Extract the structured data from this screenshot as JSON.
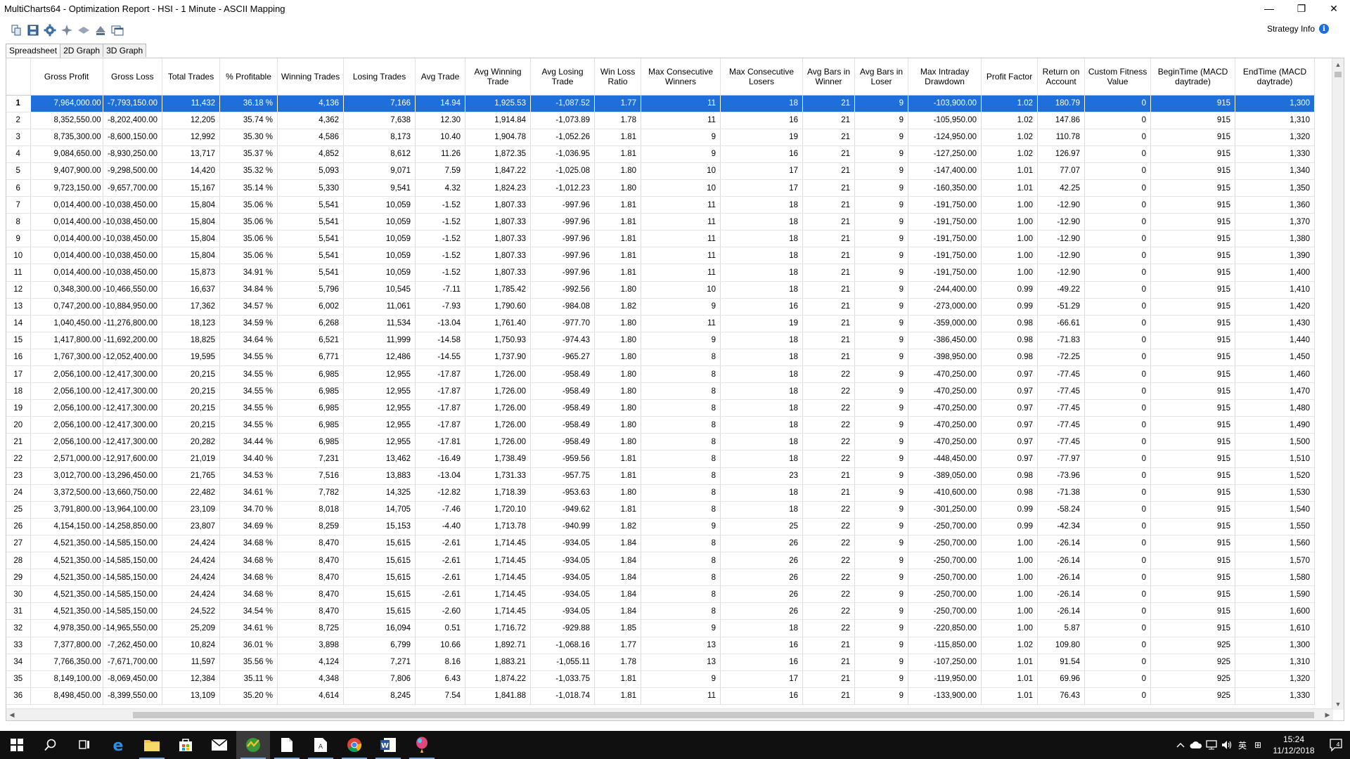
{
  "window": {
    "title": "MultiCharts64 - Optimization Report - HSI - 1 Minute - ASCII Mapping",
    "minimize": "—",
    "restore": "❐",
    "close": "✕"
  },
  "toolbar": {
    "icons": [
      "copy-icon",
      "save-icon",
      "settings-gear-icon",
      "optimize-icon",
      "hide-icon",
      "filter-icon",
      "window-icon"
    ],
    "strategy_info_label": "Strategy Info",
    "info_glyph": "i"
  },
  "tabs": [
    {
      "label": "Spreadsheet",
      "active": true
    },
    {
      "label": "2D Graph",
      "active": false
    },
    {
      "label": "3D Graph",
      "active": false
    }
  ],
  "grid": {
    "selected_row": 1,
    "columns": [
      {
        "key": "gp",
        "label": "Gross Profit"
      },
      {
        "key": "gl",
        "label": "Gross Loss"
      },
      {
        "key": "tt",
        "label": "Total Trades"
      },
      {
        "key": "pp",
        "label": "% Profitable"
      },
      {
        "key": "wt",
        "label": "Winning Trades"
      },
      {
        "key": "lt",
        "label": "Losing Trades"
      },
      {
        "key": "at",
        "label": "Avg Trade"
      },
      {
        "key": "awt",
        "label": "Avg Winning Trade"
      },
      {
        "key": "alt",
        "label": "Avg Losing Trade"
      },
      {
        "key": "wlr",
        "label": "Win Loss Ratio"
      },
      {
        "key": "mcw",
        "label": "Max Consecutive Winners"
      },
      {
        "key": "mcl",
        "label": "Max Consecutive Losers"
      },
      {
        "key": "abw",
        "label": "Avg Bars in Winner"
      },
      {
        "key": "abl",
        "label": "Avg Bars in Loser"
      },
      {
        "key": "mid",
        "label": "Max Intraday Drawdown"
      },
      {
        "key": "pf",
        "label": "Profit Factor"
      },
      {
        "key": "roa",
        "label": "Return on Account"
      },
      {
        "key": "cfv",
        "label": "Custom Fitness Value"
      },
      {
        "key": "bt",
        "label": "BeginTime (MACD daytrade)"
      },
      {
        "key": "et",
        "label": "EndTime (MACD daytrade)"
      }
    ],
    "rows": [
      [
        "1",
        "7,964,000.00",
        "-7,793,150.00",
        "11,432",
        "36.18 %",
        "4,136",
        "7,166",
        "14.94",
        "1,925.53",
        "-1,087.52",
        "1.77",
        "11",
        "18",
        "21",
        "9",
        "-103,900.00",
        "1.02",
        "180.79",
        "0",
        "915",
        "1,300"
      ],
      [
        "2",
        "8,352,550.00",
        "-8,202,400.00",
        "12,205",
        "35.74 %",
        "4,362",
        "7,638",
        "12.30",
        "1,914.84",
        "-1,073.89",
        "1.78",
        "11",
        "16",
        "21",
        "9",
        "-105,950.00",
        "1.02",
        "147.86",
        "0",
        "915",
        "1,310"
      ],
      [
        "3",
        "8,735,300.00",
        "-8,600,150.00",
        "12,992",
        "35.30 %",
        "4,586",
        "8,173",
        "10.40",
        "1,904.78",
        "-1,052.26",
        "1.81",
        "9",
        "19",
        "21",
        "9",
        "-124,950.00",
        "1.02",
        "110.78",
        "0",
        "915",
        "1,320"
      ],
      [
        "4",
        "9,084,650.00",
        "-8,930,250.00",
        "13,717",
        "35.37 %",
        "4,852",
        "8,612",
        "11.26",
        "1,872.35",
        "-1,036.95",
        "1.81",
        "9",
        "16",
        "21",
        "9",
        "-127,250.00",
        "1.02",
        "126.97",
        "0",
        "915",
        "1,330"
      ],
      [
        "5",
        "9,407,900.00",
        "-9,298,500.00",
        "14,420",
        "35.32 %",
        "5,093",
        "9,071",
        "7.59",
        "1,847.22",
        "-1,025.08",
        "1.80",
        "10",
        "17",
        "21",
        "9",
        "-147,400.00",
        "1.01",
        "77.07",
        "0",
        "915",
        "1,340"
      ],
      [
        "6",
        "9,723,150.00",
        "-9,657,700.00",
        "15,167",
        "35.14 %",
        "5,330",
        "9,541",
        "4.32",
        "1,824.23",
        "-1,012.23",
        "1.80",
        "10",
        "17",
        "21",
        "9",
        "-160,350.00",
        "1.01",
        "42.25",
        "0",
        "915",
        "1,350"
      ],
      [
        "7",
        "0,014,400.00",
        "-10,038,450.00",
        "15,804",
        "35.06 %",
        "5,541",
        "10,059",
        "-1.52",
        "1,807.33",
        "-997.96",
        "1.81",
        "11",
        "18",
        "21",
        "9",
        "-191,750.00",
        "1.00",
        "-12.90",
        "0",
        "915",
        "1,360"
      ],
      [
        "8",
        "0,014,400.00",
        "-10,038,450.00",
        "15,804",
        "35.06 %",
        "5,541",
        "10,059",
        "-1.52",
        "1,807.33",
        "-997.96",
        "1.81",
        "11",
        "18",
        "21",
        "9",
        "-191,750.00",
        "1.00",
        "-12.90",
        "0",
        "915",
        "1,370"
      ],
      [
        "9",
        "0,014,400.00",
        "-10,038,450.00",
        "15,804",
        "35.06 %",
        "5,541",
        "10,059",
        "-1.52",
        "1,807.33",
        "-997.96",
        "1.81",
        "11",
        "18",
        "21",
        "9",
        "-191,750.00",
        "1.00",
        "-12.90",
        "0",
        "915",
        "1,380"
      ],
      [
        "10",
        "0,014,400.00",
        "-10,038,450.00",
        "15,804",
        "35.06 %",
        "5,541",
        "10,059",
        "-1.52",
        "1,807.33",
        "-997.96",
        "1.81",
        "11",
        "18",
        "21",
        "9",
        "-191,750.00",
        "1.00",
        "-12.90",
        "0",
        "915",
        "1,390"
      ],
      [
        "11",
        "0,014,400.00",
        "-10,038,450.00",
        "15,873",
        "34.91 %",
        "5,541",
        "10,059",
        "-1.52",
        "1,807.33",
        "-997.96",
        "1.81",
        "11",
        "18",
        "21",
        "9",
        "-191,750.00",
        "1.00",
        "-12.90",
        "0",
        "915",
        "1,400"
      ],
      [
        "12",
        "0,348,300.00",
        "-10,466,550.00",
        "16,637",
        "34.84 %",
        "5,796",
        "10,545",
        "-7.11",
        "1,785.42",
        "-992.56",
        "1.80",
        "10",
        "18",
        "21",
        "9",
        "-244,400.00",
        "0.99",
        "-49.22",
        "0",
        "915",
        "1,410"
      ],
      [
        "13",
        "0,747,200.00",
        "-10,884,950.00",
        "17,362",
        "34.57 %",
        "6,002",
        "11,061",
        "-7.93",
        "1,790.60",
        "-984.08",
        "1.82",
        "9",
        "16",
        "21",
        "9",
        "-273,000.00",
        "0.99",
        "-51.29",
        "0",
        "915",
        "1,420"
      ],
      [
        "14",
        "1,040,450.00",
        "-11,276,800.00",
        "18,123",
        "34.59 %",
        "6,268",
        "11,534",
        "-13.04",
        "1,761.40",
        "-977.70",
        "1.80",
        "11",
        "19",
        "21",
        "9",
        "-359,000.00",
        "0.98",
        "-66.61",
        "0",
        "915",
        "1,430"
      ],
      [
        "15",
        "1,417,800.00",
        "-11,692,200.00",
        "18,825",
        "34.64 %",
        "6,521",
        "11,999",
        "-14.58",
        "1,750.93",
        "-974.43",
        "1.80",
        "9",
        "18",
        "21",
        "9",
        "-386,450.00",
        "0.98",
        "-71.83",
        "0",
        "915",
        "1,440"
      ],
      [
        "16",
        "1,767,300.00",
        "-12,052,400.00",
        "19,595",
        "34.55 %",
        "6,771",
        "12,486",
        "-14.55",
        "1,737.90",
        "-965.27",
        "1.80",
        "8",
        "18",
        "21",
        "9",
        "-398,950.00",
        "0.98",
        "-72.25",
        "0",
        "915",
        "1,450"
      ],
      [
        "17",
        "2,056,100.00",
        "-12,417,300.00",
        "20,215",
        "34.55 %",
        "6,985",
        "12,955",
        "-17.87",
        "1,726.00",
        "-958.49",
        "1.80",
        "8",
        "18",
        "22",
        "9",
        "-470,250.00",
        "0.97",
        "-77.45",
        "0",
        "915",
        "1,460"
      ],
      [
        "18",
        "2,056,100.00",
        "-12,417,300.00",
        "20,215",
        "34.55 %",
        "6,985",
        "12,955",
        "-17.87",
        "1,726.00",
        "-958.49",
        "1.80",
        "8",
        "18",
        "22",
        "9",
        "-470,250.00",
        "0.97",
        "-77.45",
        "0",
        "915",
        "1,470"
      ],
      [
        "19",
        "2,056,100.00",
        "-12,417,300.00",
        "20,215",
        "34.55 %",
        "6,985",
        "12,955",
        "-17.87",
        "1,726.00",
        "-958.49",
        "1.80",
        "8",
        "18",
        "22",
        "9",
        "-470,250.00",
        "0.97",
        "-77.45",
        "0",
        "915",
        "1,480"
      ],
      [
        "20",
        "2,056,100.00",
        "-12,417,300.00",
        "20,215",
        "34.55 %",
        "6,985",
        "12,955",
        "-17.87",
        "1,726.00",
        "-958.49",
        "1.80",
        "8",
        "18",
        "22",
        "9",
        "-470,250.00",
        "0.97",
        "-77.45",
        "0",
        "915",
        "1,490"
      ],
      [
        "21",
        "2,056,100.00",
        "-12,417,300.00",
        "20,282",
        "34.44 %",
        "6,985",
        "12,955",
        "-17.81",
        "1,726.00",
        "-958.49",
        "1.80",
        "8",
        "18",
        "22",
        "9",
        "-470,250.00",
        "0.97",
        "-77.45",
        "0",
        "915",
        "1,500"
      ],
      [
        "22",
        "2,571,000.00",
        "-12,917,600.00",
        "21,019",
        "34.40 %",
        "7,231",
        "13,462",
        "-16.49",
        "1,738.49",
        "-959.56",
        "1.81",
        "8",
        "18",
        "22",
        "9",
        "-448,450.00",
        "0.97",
        "-77.97",
        "0",
        "915",
        "1,510"
      ],
      [
        "23",
        "3,012,700.00",
        "-13,296,450.00",
        "21,765",
        "34.53 %",
        "7,516",
        "13,883",
        "-13.04",
        "1,731.33",
        "-957.75",
        "1.81",
        "8",
        "23",
        "21",
        "9",
        "-389,050.00",
        "0.98",
        "-73.96",
        "0",
        "915",
        "1,520"
      ],
      [
        "24",
        "3,372,500.00",
        "-13,660,750.00",
        "22,482",
        "34.61 %",
        "7,782",
        "14,325",
        "-12.82",
        "1,718.39",
        "-953.63",
        "1.80",
        "8",
        "18",
        "21",
        "9",
        "-410,600.00",
        "0.98",
        "-71.38",
        "0",
        "915",
        "1,530"
      ],
      [
        "25",
        "3,791,800.00",
        "-13,964,100.00",
        "23,109",
        "34.70 %",
        "8,018",
        "14,705",
        "-7.46",
        "1,720.10",
        "-949.62",
        "1.81",
        "8",
        "18",
        "22",
        "9",
        "-301,250.00",
        "0.99",
        "-58.24",
        "0",
        "915",
        "1,540"
      ],
      [
        "26",
        "4,154,150.00",
        "-14,258,850.00",
        "23,807",
        "34.69 %",
        "8,259",
        "15,153",
        "-4.40",
        "1,713.78",
        "-940.99",
        "1.82",
        "9",
        "25",
        "22",
        "9",
        "-250,700.00",
        "0.99",
        "-42.34",
        "0",
        "915",
        "1,550"
      ],
      [
        "27",
        "4,521,350.00",
        "-14,585,150.00",
        "24,424",
        "34.68 %",
        "8,470",
        "15,615",
        "-2.61",
        "1,714.45",
        "-934.05",
        "1.84",
        "8",
        "26",
        "22",
        "9",
        "-250,700.00",
        "1.00",
        "-26.14",
        "0",
        "915",
        "1,560"
      ],
      [
        "28",
        "4,521,350.00",
        "-14,585,150.00",
        "24,424",
        "34.68 %",
        "8,470",
        "15,615",
        "-2.61",
        "1,714.45",
        "-934.05",
        "1.84",
        "8",
        "26",
        "22",
        "9",
        "-250,700.00",
        "1.00",
        "-26.14",
        "0",
        "915",
        "1,570"
      ],
      [
        "29",
        "4,521,350.00",
        "-14,585,150.00",
        "24,424",
        "34.68 %",
        "8,470",
        "15,615",
        "-2.61",
        "1,714.45",
        "-934.05",
        "1.84",
        "8",
        "26",
        "22",
        "9",
        "-250,700.00",
        "1.00",
        "-26.14",
        "0",
        "915",
        "1,580"
      ],
      [
        "30",
        "4,521,350.00",
        "-14,585,150.00",
        "24,424",
        "34.68 %",
        "8,470",
        "15,615",
        "-2.61",
        "1,714.45",
        "-934.05",
        "1.84",
        "8",
        "26",
        "22",
        "9",
        "-250,700.00",
        "1.00",
        "-26.14",
        "0",
        "915",
        "1,590"
      ],
      [
        "31",
        "4,521,350.00",
        "-14,585,150.00",
        "24,522",
        "34.54 %",
        "8,470",
        "15,615",
        "-2.60",
        "1,714.45",
        "-934.05",
        "1.84",
        "8",
        "26",
        "22",
        "9",
        "-250,700.00",
        "1.00",
        "-26.14",
        "0",
        "915",
        "1,600"
      ],
      [
        "32",
        "4,978,350.00",
        "-14,965,550.00",
        "25,209",
        "34.61 %",
        "8,725",
        "16,094",
        "0.51",
        "1,716.72",
        "-929.88",
        "1.85",
        "9",
        "18",
        "22",
        "9",
        "-220,850.00",
        "1.00",
        "5.87",
        "0",
        "915",
        "1,610"
      ],
      [
        "33",
        "7,377,800.00",
        "-7,262,450.00",
        "10,824",
        "36.01 %",
        "3,898",
        "6,799",
        "10.66",
        "1,892.71",
        "-1,068.16",
        "1.77",
        "13",
        "16",
        "21",
        "9",
        "-115,850.00",
        "1.02",
        "109.80",
        "0",
        "925",
        "1,300"
      ],
      [
        "34",
        "7,766,350.00",
        "-7,671,700.00",
        "11,597",
        "35.56 %",
        "4,124",
        "7,271",
        "8.16",
        "1,883.21",
        "-1,055.11",
        "1.78",
        "13",
        "16",
        "21",
        "9",
        "-107,250.00",
        "1.01",
        "91.54",
        "0",
        "925",
        "1,310"
      ],
      [
        "35",
        "8,149,100.00",
        "-8,069,450.00",
        "12,384",
        "35.11 %",
        "4,348",
        "7,806",
        "6.43",
        "1,874.22",
        "-1,033.75",
        "1.81",
        "9",
        "17",
        "21",
        "9",
        "-119,950.00",
        "1.01",
        "69.96",
        "0",
        "925",
        "1,320"
      ],
      [
        "36",
        "8,498,450.00",
        "-8,399,550.00",
        "13,109",
        "35.20 %",
        "4,614",
        "8,245",
        "7.54",
        "1,841.88",
        "-1,018.74",
        "1.81",
        "11",
        "16",
        "21",
        "9",
        "-133,900.00",
        "1.01",
        "76.43",
        "0",
        "925",
        "1,330"
      ]
    ]
  },
  "taskbar": {
    "apps": [
      {
        "name": "start-icon"
      },
      {
        "name": "search-icon"
      },
      {
        "name": "task-view-icon"
      },
      {
        "name": "edge-icon"
      },
      {
        "name": "file-explorer-icon"
      },
      {
        "name": "store-icon"
      },
      {
        "name": "mail-icon"
      },
      {
        "name": "multicharts-icon"
      },
      {
        "name": "document-icon"
      },
      {
        "name": "excel-like-icon"
      },
      {
        "name": "chrome-icon"
      },
      {
        "name": "word-icon"
      },
      {
        "name": "balloon-icon"
      }
    ],
    "ime_label": "英",
    "ime2_label": "⊞",
    "time": "15:24",
    "date": "11/12/2018",
    "notification_count": "4"
  },
  "colors": {
    "selection": "#1e6fd9",
    "taskbar": "#101010"
  }
}
